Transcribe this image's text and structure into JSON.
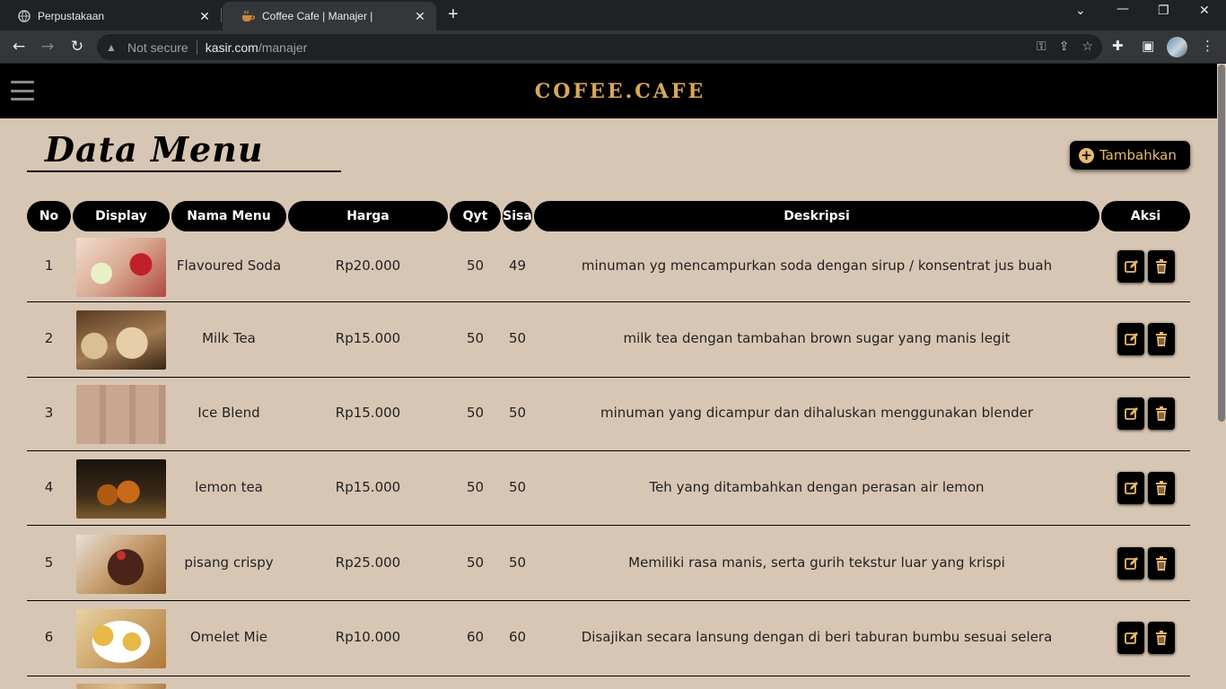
{
  "browser": {
    "tabs": [
      {
        "title": "Perpustakaan",
        "icon": "globe-icon"
      },
      {
        "title": "Coffee Cafe | Manajer |",
        "icon": "coffee-cup-icon",
        "active": true
      }
    ],
    "address": {
      "security": "Not secure",
      "host": "kasir.com",
      "path": "/manajer"
    }
  },
  "site": {
    "brand": "COFEE.CAFE"
  },
  "page": {
    "title": "Data Menu",
    "add_label": "Tambahkan"
  },
  "table": {
    "headers": {
      "no": "No",
      "display": "Display",
      "nama": "Nama Menu",
      "harga": "Harga",
      "qty": "Qyt",
      "sisa": "Sisa",
      "deskripsi": "Deskripsi",
      "aksi": "Aksi"
    },
    "rows": [
      {
        "no": "1",
        "nama": "Flavoured Soda",
        "harga": "Rp20.000",
        "qty": "50",
        "sisa": "49",
        "deskripsi": "minuman yg mencampurkan soda dengan sirup / konsentrat jus buah"
      },
      {
        "no": "2",
        "nama": "Milk Tea",
        "harga": "Rp15.000",
        "qty": "50",
        "sisa": "50",
        "deskripsi": "milk tea dengan tambahan brown sugar yang manis legit"
      },
      {
        "no": "3",
        "nama": "Ice Blend",
        "harga": "Rp15.000",
        "qty": "50",
        "sisa": "50",
        "deskripsi": "minuman yang dicampur dan dihaluskan menggunakan blender"
      },
      {
        "no": "4",
        "nama": "lemon tea",
        "harga": "Rp15.000",
        "qty": "50",
        "sisa": "50",
        "deskripsi": "Teh yang ditambahkan dengan perasan air lemon"
      },
      {
        "no": "5",
        "nama": "pisang crispy",
        "harga": "Rp25.000",
        "qty": "50",
        "sisa": "50",
        "deskripsi": "Memiliki rasa manis, serta gurih tekstur luar yang krispi"
      },
      {
        "no": "6",
        "nama": "Omelet Mie",
        "harga": "Rp10.000",
        "qty": "60",
        "sisa": "60",
        "deskripsi": "Disajikan secara lansung dengan di beri taburan bumbu sesuai selera"
      }
    ]
  },
  "colors": {
    "page_bg": "#d8c6b4",
    "accent": "#e9b970",
    "brand": "#d6a85a"
  }
}
